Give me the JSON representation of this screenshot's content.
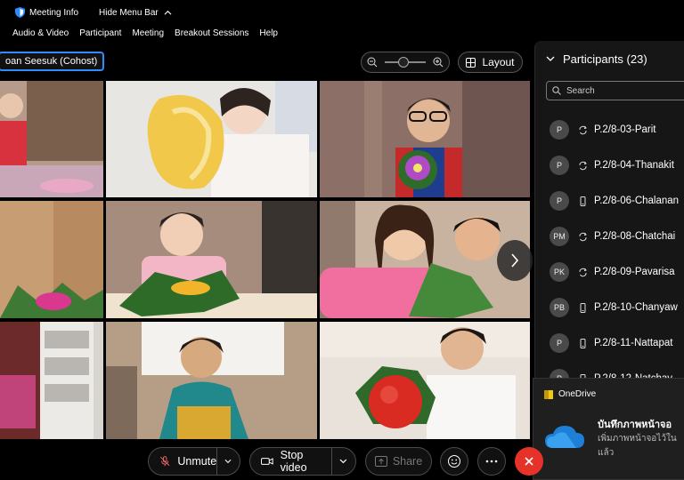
{
  "topbar": {
    "meeting_info": "Meeting Info",
    "hide_menu": "Hide Menu Bar"
  },
  "menubar": {
    "items": [
      "Audio & Video",
      "Participant",
      "Meeting",
      "Breakout Sessions",
      "Help"
    ]
  },
  "presenter_label": "oan Seesuk (Cohost)",
  "view": {
    "layout_label": "Layout"
  },
  "participants": {
    "title": "Participants (23)",
    "search_placeholder": "Search",
    "list": [
      {
        "initials": "P",
        "name": "P.2/8-03-Parit",
        "device": "sync-icon"
      },
      {
        "initials": "P",
        "name": "P.2/8-04-Thanakit",
        "device": "sync-icon"
      },
      {
        "initials": "P",
        "name": "P.2/8-06-Chalanan",
        "device": "mobile-icon"
      },
      {
        "initials": "PM",
        "name": "P.2/8-08-Chatchai",
        "device": "sync-icon"
      },
      {
        "initials": "PK",
        "name": "P.2/8-09-Pavarisa",
        "device": "sync-icon"
      },
      {
        "initials": "PB",
        "name": "P.2/8-10-Chanyaw",
        "device": "mobile-icon"
      },
      {
        "initials": "P",
        "name": "P.2/8-11-Nattapat",
        "device": "mobile-icon"
      },
      {
        "initials": "P",
        "name": "P.2/8-12-Natchay",
        "device": "mobile-icon"
      }
    ]
  },
  "toast": {
    "app": "OneDrive",
    "title": "บันทึกภาพหน้าจอ",
    "body_line1": "เพิ่มภาพหน้าจอไว้ใน",
    "body_line2": "แล้ว"
  },
  "controls": {
    "unmute": "Unmute",
    "stop_video": "Stop video",
    "share": "Share"
  },
  "colors": {
    "accent": "#2d8cff",
    "leave": "#e5332a",
    "panel_bg": "#161616"
  }
}
